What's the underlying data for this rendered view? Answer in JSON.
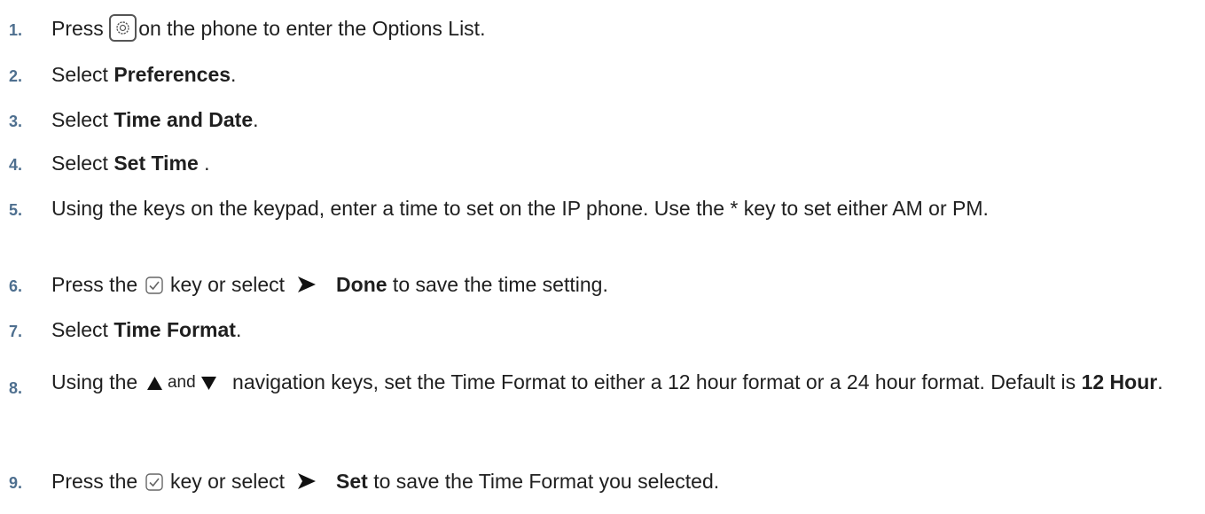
{
  "steps": [
    {
      "num": "1.",
      "a": "Press",
      "b": "on the phone to enter the Options List."
    },
    {
      "num": "2.",
      "a": "Select ",
      "bold": "Preferences",
      "b": "."
    },
    {
      "num": "3.",
      "a": "Select ",
      "bold": "Time and Date",
      "b": "."
    },
    {
      "num": "4.",
      "a": "Select ",
      "bold": "Set Time",
      "b": " ."
    },
    {
      "num": "5.",
      "a": "Using the keys on the keypad, enter a time to set on the IP phone. Use the * key to set either AM or PM."
    },
    {
      "num": "6.",
      "a": "Press the",
      "b": "key or select",
      "bold": "Done",
      "c": " to save the time setting."
    },
    {
      "num": "7.",
      "a": "Select ",
      "bold": "Time Format",
      "b": "."
    },
    {
      "num": "8.",
      "a": "Using the",
      "and": "and",
      "b": "navigation keys, set the Time Format to either a 12 hour format or a 24 hour format. Default is ",
      "bold": "12 Hour",
      "c": "."
    },
    {
      "num": "9.",
      "a": "Press the",
      "b": "key or select",
      "bold": "Set",
      "c": " to save the Time Format you selected."
    }
  ],
  "icons": {
    "settings": "settings-gear-key-icon",
    "check": "checkmark-key-icon",
    "select": "play-arrow-icon",
    "nav_up": "up-arrow-icon",
    "nav_down": "down-arrow-icon"
  }
}
